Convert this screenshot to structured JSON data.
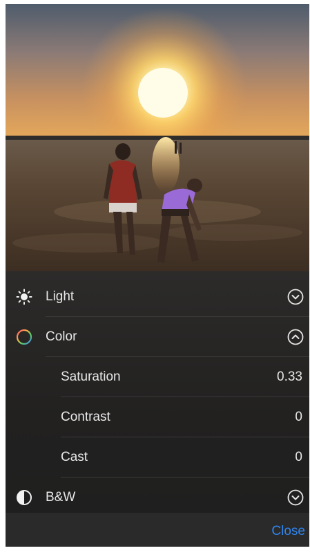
{
  "photo": {
    "subject": "sunset-beach-photo"
  },
  "adjustments": {
    "light": {
      "label": "Light",
      "icon": "sun-icon",
      "state": "collapsed"
    },
    "color": {
      "label": "Color",
      "icon": "color-wheel-icon",
      "state": "expanded"
    },
    "saturation": {
      "label": "Saturation",
      "value": "0.33"
    },
    "contrast": {
      "label": "Contrast",
      "value": "0"
    },
    "cast": {
      "label": "Cast",
      "value": "0"
    },
    "bw": {
      "label": "B&W",
      "icon": "half-circle-icon",
      "state": "collapsed"
    }
  },
  "toolbar": {
    "close_label": "Close"
  },
  "colors": {
    "accent": "#2f86f0",
    "panel": "#232221",
    "text": "#e8e8e8"
  }
}
